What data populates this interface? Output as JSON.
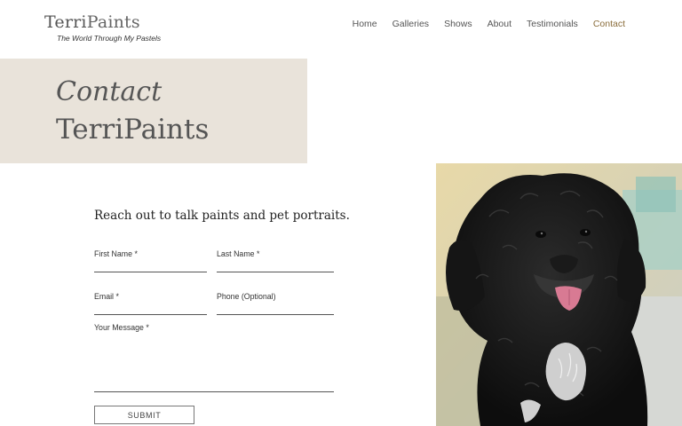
{
  "brand": {
    "name_part1": "Terri",
    "name_part2": "Paints",
    "tagline": "The World Through My Pastels"
  },
  "nav": {
    "items": [
      {
        "label": "Home",
        "active": false
      },
      {
        "label": "Galleries",
        "active": false
      },
      {
        "label": "Shows",
        "active": false
      },
      {
        "label": "About",
        "active": false
      },
      {
        "label": "Testimonials",
        "active": false
      },
      {
        "label": "Contact",
        "active": true
      }
    ]
  },
  "hero": {
    "line1": "Contact",
    "line2": "TerriPaints"
  },
  "form": {
    "intro": "Reach out to talk paints and pet portraits.",
    "first_name_label": "First Name *",
    "last_name_label": "Last Name *",
    "email_label": "Email *",
    "phone_label": "Phone (Optional)",
    "message_label": "Your Message *",
    "submit_label": "SUBMIT"
  },
  "colors": {
    "hero_bg": "#e9e3da",
    "active_nav": "#8a6d3b"
  }
}
